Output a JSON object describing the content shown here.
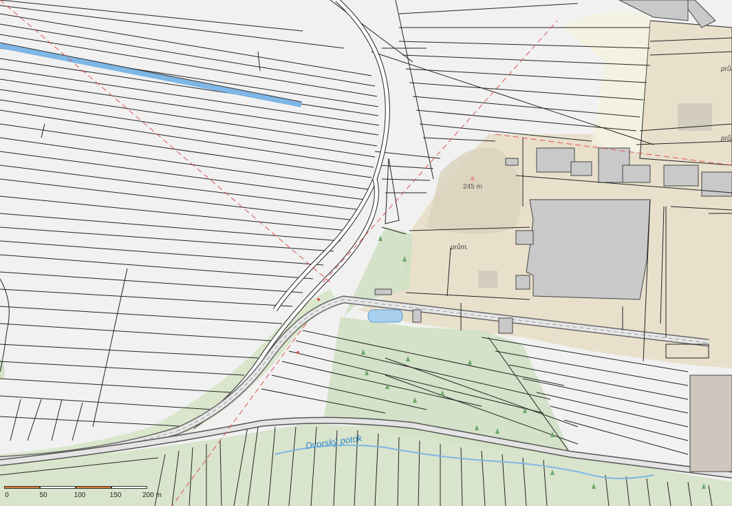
{
  "map": {
    "elevation_label": "245 m",
    "landuse_labels": [
      "prům.",
      "prům.",
      "prům."
    ],
    "stream_name": "Dvorský potok"
  },
  "scale": {
    "ticks": [
      "0",
      "50",
      "100",
      "150",
      "200 m"
    ]
  },
  "colors": {
    "background": "#eeeeee",
    "field_fill": "#f1f1f1",
    "parcel_line": "#222222",
    "industrial": "#e9e0cc",
    "building": "#c9c9c9",
    "meadow": "#cfe0c3",
    "road": "#ffffff",
    "water_line": "#7eb6e6",
    "stream_text": "#2f88c8",
    "boundary_red": "#e05050",
    "scale_orange": "#e07b39"
  },
  "icons": [
    "elevation-triangle-icon",
    "tree-icon",
    "scale-bar"
  ]
}
